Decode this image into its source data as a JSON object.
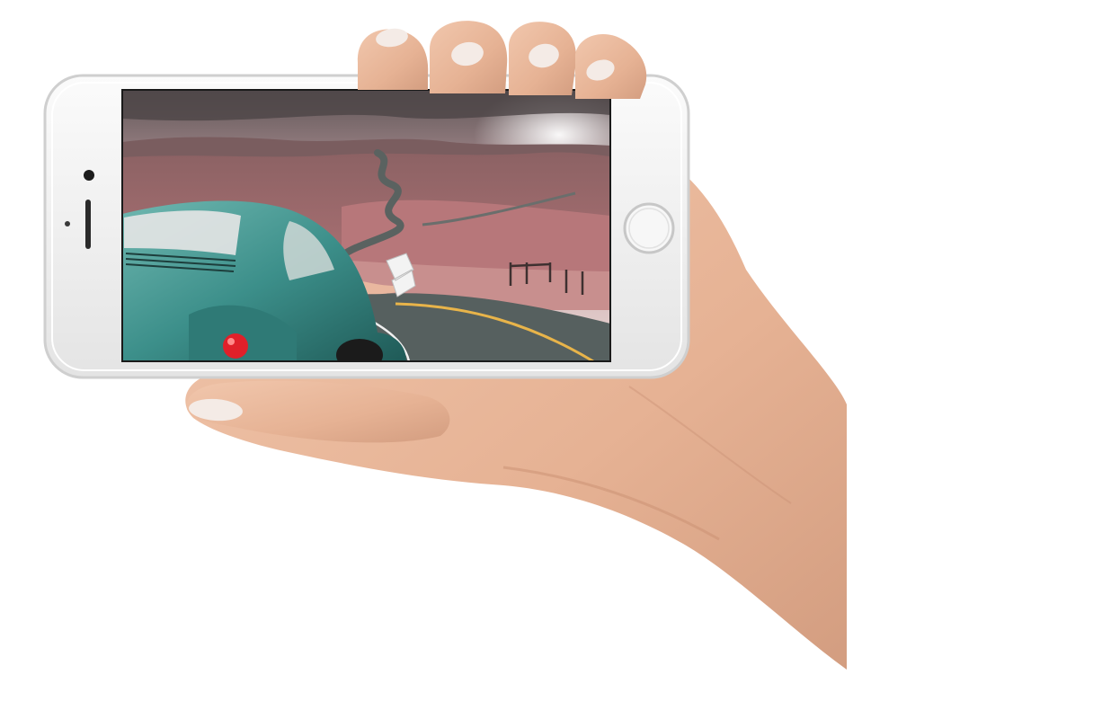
{
  "scene": {
    "subject": "hand-holding-phone",
    "device": "white-smartphone-landscape",
    "screen_content": "vintage-beetle-on-winding-road"
  },
  "colors": {
    "background": "#ffffff",
    "skin": "#e9b89c",
    "skin_shadow": "#c98f72",
    "nail": "#f4ebe6",
    "phone_body": "#f2f2f2",
    "phone_edge": "#cfcfcf",
    "sky": "#c9a3a8",
    "hills": "#a86b6f",
    "road": "#56605f",
    "car": "#3c8f8a",
    "taillight": "#e0202a"
  }
}
